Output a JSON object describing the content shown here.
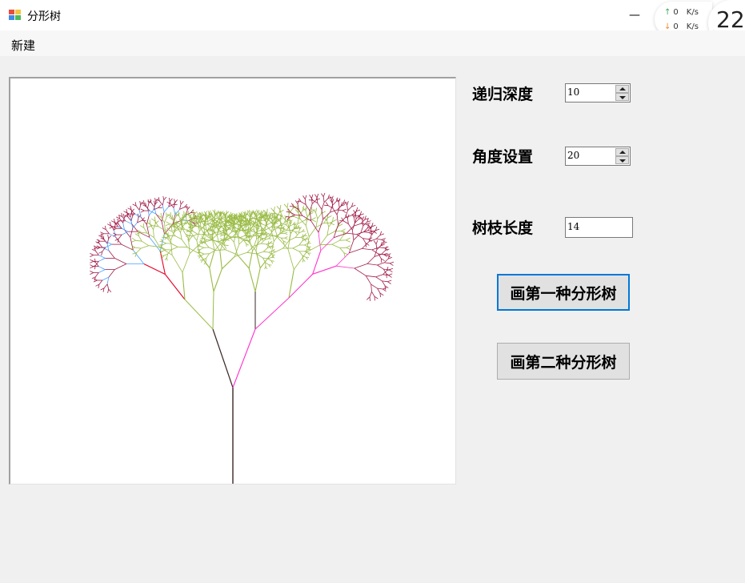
{
  "window": {
    "title": "分形树",
    "minimize_glyph": "—"
  },
  "net_widget": {
    "upload_value": "0",
    "upload_unit": "K/s",
    "download_value": "0",
    "download_unit": "K/s"
  },
  "cpu_widget": {
    "value": "22"
  },
  "menu": {
    "items": [
      {
        "label": "新建"
      }
    ]
  },
  "controls": {
    "depth": {
      "label": "递归深度",
      "value": "10"
    },
    "angle": {
      "label": "角度设置",
      "value": "20"
    },
    "branch_length": {
      "label": "树枝长度",
      "value": "14"
    }
  },
  "buttons": {
    "draw_first": "画第一种分形树",
    "draw_second": "画第二种分形树"
  },
  "tree_colors": [
    "#3b2626",
    "#ff33cc",
    "#99bb44",
    "#e60026",
    "#4aa0ff",
    "#a21d4a"
  ]
}
